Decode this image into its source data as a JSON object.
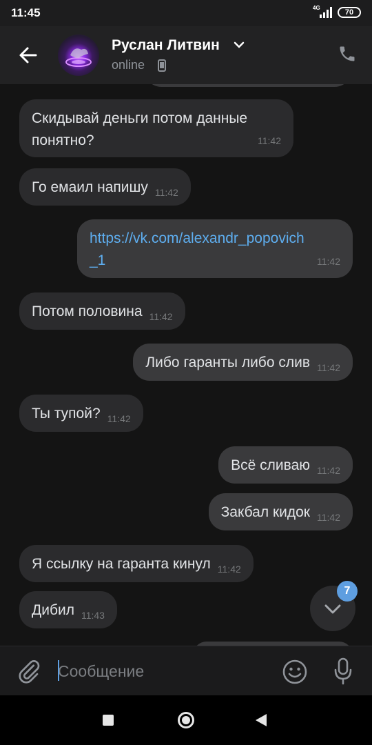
{
  "status_bar": {
    "time": "11:45",
    "network": "4G",
    "battery": "70"
  },
  "header": {
    "contact_name": "Руслан Литвин",
    "status": "online",
    "icons": [
      "back-arrow-icon",
      "chevron-down-icon",
      "mobile-phone-icon",
      "phone-call-icon"
    ]
  },
  "messages": [
    {
      "direction": "in",
      "text": "Скидывай деньги потом данные понятно?",
      "time": "11:42"
    },
    {
      "direction": "in",
      "text": "Го емаил напишу",
      "time": "11:42"
    },
    {
      "direction": "out",
      "text": "https://vk.com/alexandr_popovich_1",
      "link_line1": "https://vk.com/alexandr_popovich",
      "link_line2": "_1",
      "time": "11:42"
    },
    {
      "direction": "in",
      "text": "Потом половина",
      "time": "11:42"
    },
    {
      "direction": "out",
      "text": "Либо гаранты либо слив",
      "time": "11:42"
    },
    {
      "direction": "in",
      "text": "Ты тупой?",
      "time": "11:42"
    },
    {
      "direction": "out",
      "text": "Всё сливаю",
      "time": "11:42"
    },
    {
      "direction": "out",
      "text": "Закбал кидок",
      "time": "11:42"
    },
    {
      "direction": "in",
      "text": "Я ссылку на гаранта кинул",
      "time": "11:42"
    },
    {
      "direction": "in",
      "text": "Дибил",
      "time": "11:43"
    }
  ],
  "scroll_down": {
    "unread_count": "7"
  },
  "composer": {
    "placeholder": "Сообщение"
  },
  "colors": {
    "accent": "#5e9ee0",
    "link": "#5eaef0",
    "incoming_bubble": "#2b2b2d",
    "outgoing_bubble": "#3a3a3c"
  }
}
